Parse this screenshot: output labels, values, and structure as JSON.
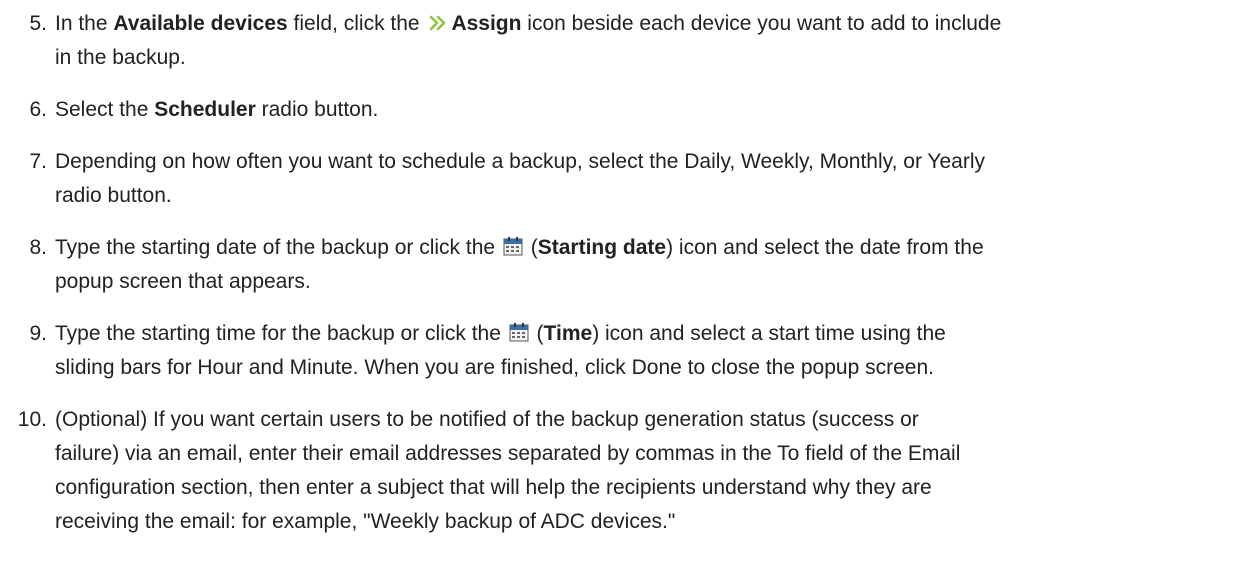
{
  "steps": [
    {
      "number": "5.",
      "pre": "In the ",
      "bold1": "Available devices",
      "mid1": " field, click the ",
      "icon": "assign-chevron-icon",
      "bold2": "Assign",
      "line1_rest": " icon beside each device you want to add to include",
      "line2": "in the backup."
    },
    {
      "number": "6.",
      "pre": "Select the ",
      "bold1": "Scheduler",
      "post": " radio button."
    },
    {
      "number": "7.",
      "line1": "Depending on how often you want to schedule a backup, select the Daily, Weekly, Monthly, or Yearly",
      "line2": "radio button."
    },
    {
      "number": "8.",
      "pre": "Type the starting date of the backup or click the ",
      "icon": "calendar-icon",
      "paren_open": " (",
      "bold1": "Starting date",
      "line1_rest": ") icon and select the date from the",
      "line2": "popup screen that appears."
    },
    {
      "number": "9.",
      "pre": "Type the starting time for the backup or click the ",
      "icon": "calendar-icon",
      "paren_open": " (",
      "bold1": "Time",
      "line1_rest": ") icon and select a start time using the",
      "line2": "sliding bars for Hour and Minute. When you are finished, click Done to close the popup screen."
    },
    {
      "number": "10.",
      "line1": "(Optional) If you want certain users to be notified of the backup generation status (success or",
      "line2": "failure) via an email, enter their email addresses separated by commas in the To field of the Email",
      "line3": "configuration section, then enter a subject that will help the recipients understand why they are",
      "line4": "receiving the email: for example, \"Weekly backup of ADC devices.\""
    }
  ],
  "colors": {
    "text": "#222222",
    "assign_icon": "#8dc63f",
    "calendar_icon": "#3a6ea5"
  }
}
